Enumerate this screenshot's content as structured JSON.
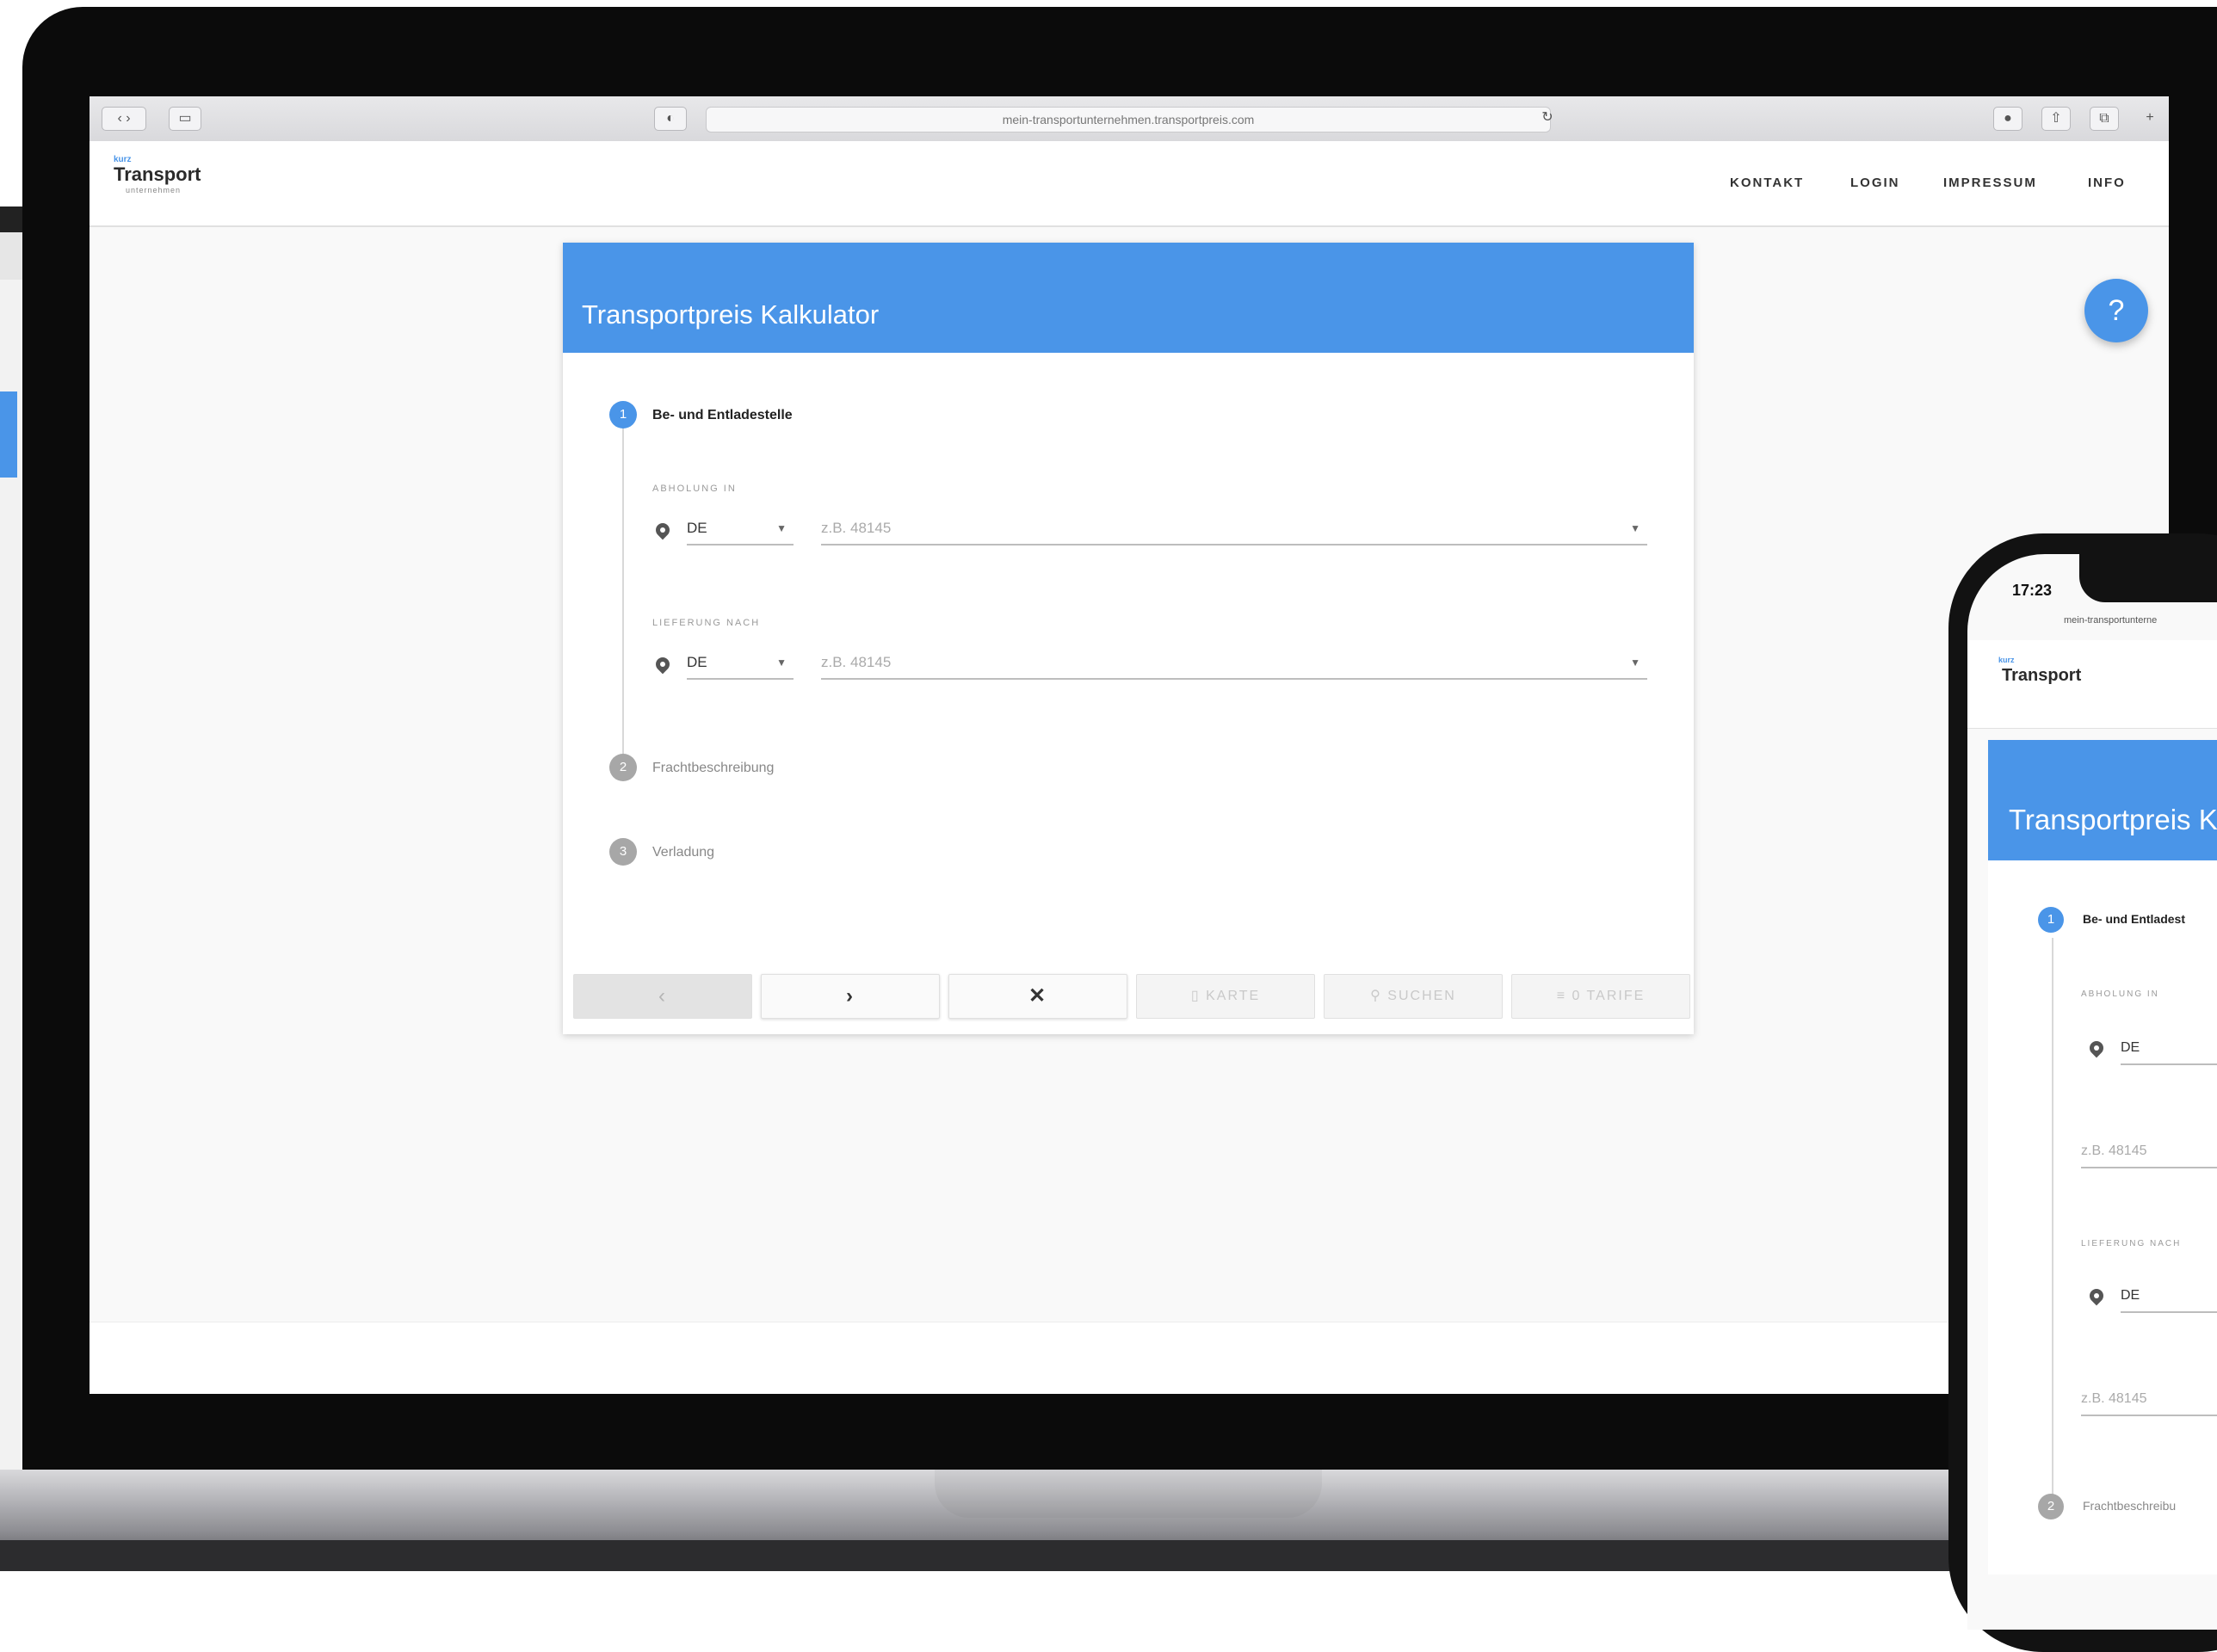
{
  "browser": {
    "url": "mein-transportunternehmen.transportpreis.com",
    "back_icon": "chevron-left",
    "forward_icon": "chevron-right"
  },
  "site": {
    "logo_sup": "kurz",
    "logo": "Transport",
    "logo_sub": "unternehmen",
    "nav": [
      "KONTAKT",
      "LOGIN",
      "IMPRESSUM",
      "INFO"
    ],
    "help_label": "?"
  },
  "calculator": {
    "title": "Transportpreis Kalkulator",
    "steps": [
      {
        "number": "1",
        "label": "Be- und Entladestelle",
        "active": true
      },
      {
        "number": "2",
        "label": "Frachtbeschreibung",
        "active": false
      },
      {
        "number": "3",
        "label": "Verladung",
        "active": false
      }
    ],
    "pickup": {
      "label": "ABHOLUNG IN",
      "country": "DE",
      "zip_placeholder": "z.B. 48145"
    },
    "delivery": {
      "label": "LIEFERUNG NACH",
      "country": "DE",
      "zip_placeholder": "z.B. 48145"
    },
    "buttons": {
      "prev": "‹",
      "next": "›",
      "clear": "✕",
      "map": "KARTE",
      "search": "SUCHEN",
      "tariffs": "0 TARIFE"
    }
  },
  "phone": {
    "time": "17:23",
    "url": "mein-transportunterne",
    "logo": "Transport",
    "title": "Transportpreis K",
    "step1": "Be- und Entladest",
    "pickup_label": "ABHOLUNG IN",
    "pickup_country": "DE",
    "pickup_zip": "z.B. 48145",
    "delivery_label": "LIEFERUNG NACH",
    "delivery_country": "DE",
    "delivery_zip": "z.B. 48145",
    "step2": "Frachtbeschreibu"
  }
}
